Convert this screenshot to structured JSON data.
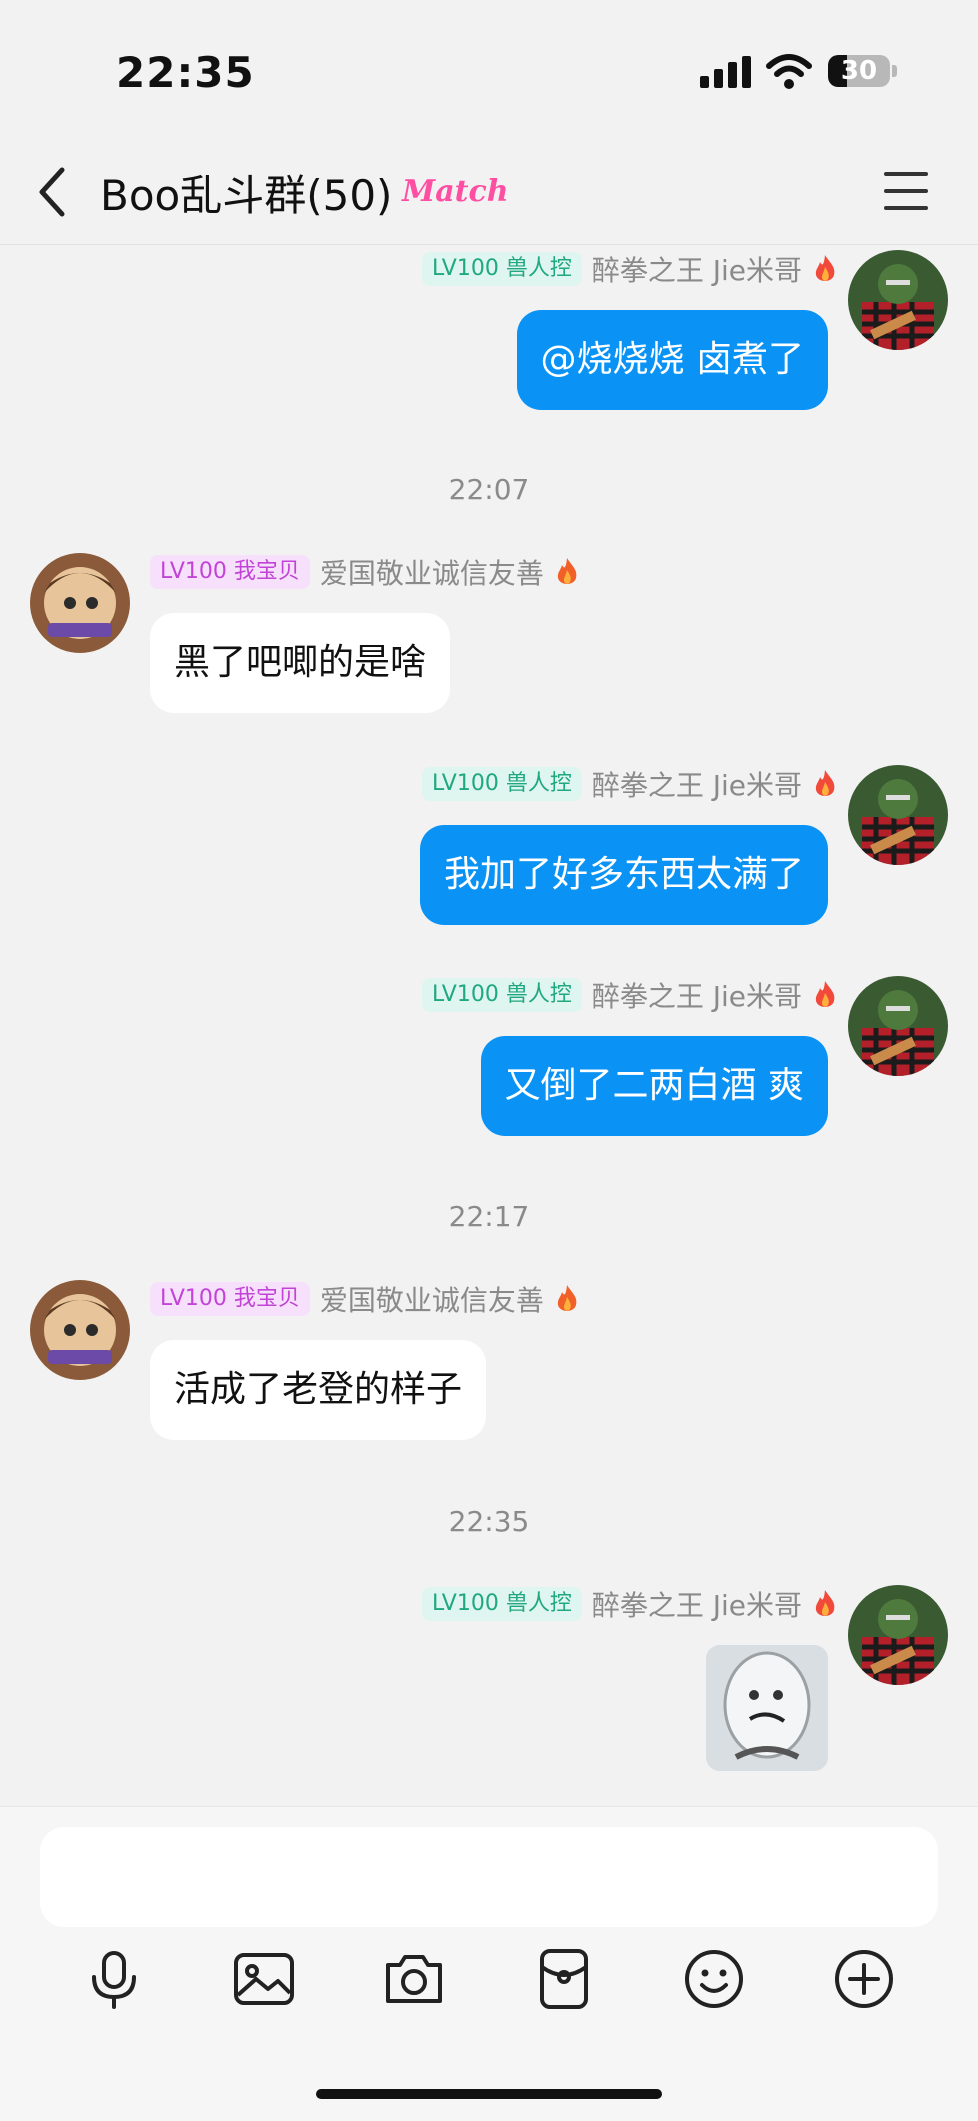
{
  "status_bar": {
    "time": "22:35",
    "battery": "30",
    "battery_level": 0.3
  },
  "header": {
    "title": "Boo乱斗群(50)",
    "badge": "Match"
  },
  "messages": [
    {
      "type": "message",
      "side": "right",
      "level": "LV100 兽人控",
      "sender": "醉拳之王 Jie米哥",
      "text": "@烧烧烧 卤煮了"
    },
    {
      "type": "time",
      "text": "22:07"
    },
    {
      "type": "message",
      "side": "left",
      "level": "LV100 我宝贝",
      "sender": "爱国敬业诚信友善",
      "text": "黑了吧唧的是啥"
    },
    {
      "type": "message",
      "side": "right",
      "level": "LV100 兽人控",
      "sender": "醉拳之王 Jie米哥",
      "text": "我加了好多东西太满了"
    },
    {
      "type": "message",
      "side": "right",
      "level": "LV100 兽人控",
      "sender": "醉拳之王 Jie米哥",
      "text": "又倒了二两白酒 爽"
    },
    {
      "type": "time",
      "text": "22:17"
    },
    {
      "type": "message",
      "side": "left",
      "level": "LV100 我宝贝",
      "sender": "爱国敬业诚信友善",
      "text": "活成了老登的样子"
    },
    {
      "type": "time",
      "text": "22:35"
    },
    {
      "type": "sticker",
      "side": "right",
      "level": "LV100 兽人控",
      "sender": "醉拳之王 Jie米哥"
    }
  ],
  "input": {
    "placeholder": ""
  },
  "toolbar": {
    "icons": [
      "microphone-icon",
      "image-icon",
      "camera-icon",
      "red-packet-icon",
      "emoji-icon",
      "plus-icon"
    ]
  },
  "colors": {
    "outgoing_bubble": "#0a93f5",
    "incoming_bubble": "#ffffff",
    "badge_green": "#20a87e",
    "badge_pink": "#c144d6",
    "match_pink": "#ff4fa3"
  }
}
